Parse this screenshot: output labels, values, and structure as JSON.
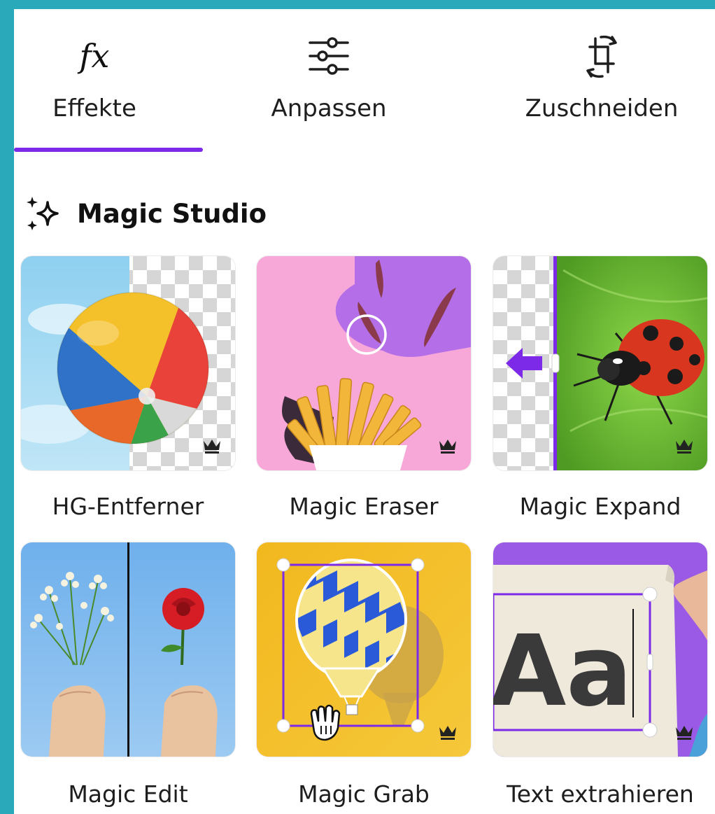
{
  "tabs": [
    {
      "label": "Effekte",
      "icon": "fx-icon",
      "active": true
    },
    {
      "label": "Anpassen",
      "icon": "sliders-icon",
      "active": false
    },
    {
      "label": "Zuschneiden",
      "icon": "crop-rotate-icon",
      "active": false
    }
  ],
  "section": {
    "title": "Magic Studio",
    "icon": "sparkle-icon"
  },
  "tools": [
    {
      "label": "HG-Entferner",
      "premium": true
    },
    {
      "label": "Magic Eraser",
      "premium": true
    },
    {
      "label": "Magic Expand",
      "premium": true
    },
    {
      "label": "Magic Edit",
      "premium": false
    },
    {
      "label": "Magic Grab",
      "premium": true
    },
    {
      "label": "Text extrahieren",
      "premium": true
    }
  ],
  "thumb_text": {
    "aa": "Aa"
  },
  "colors": {
    "accent": "#7d2ae8",
    "background": "#2aa9bb"
  }
}
